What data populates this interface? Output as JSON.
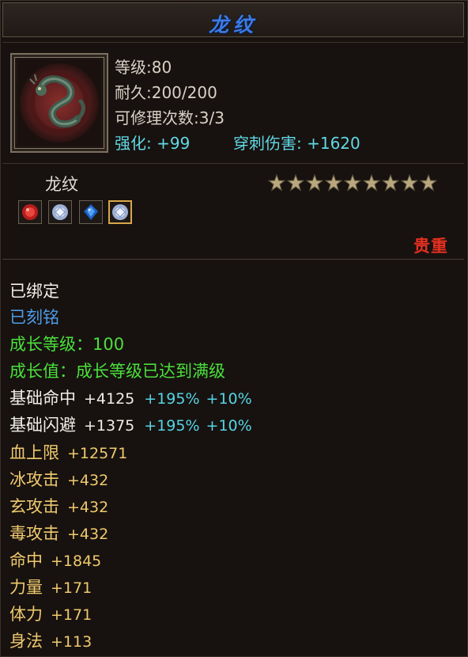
{
  "title": "龙纹",
  "stats": {
    "level": "等级:80",
    "durability": "耐久:200/200",
    "repairs": "可修理次数:3/3",
    "enhance": "强化: +99",
    "pierce": "穿刺伤害: +1620"
  },
  "item_name": "龙纹",
  "stars": {
    "count": 9,
    "color": "#b9a87e"
  },
  "gems": [
    {
      "icon": "red-gem-icon",
      "color": "#d42a2a"
    },
    {
      "icon": "white-gem-icon",
      "color": "#dfe8f6"
    },
    {
      "icon": "blue-gem-icon",
      "color": "#2f7fe6"
    },
    {
      "icon": "white-gem-icon",
      "color": "#dfe8f6",
      "selected": true
    }
  ],
  "rarity": "贵重",
  "attributes": {
    "bound": "已绑定",
    "engraved": "已刻铭",
    "growth_level": "成长等级：100",
    "growth_value": "成长值：成长等级已达到满级",
    "base_hit": {
      "label": "基础命中",
      "value": "+4125",
      "bonus1": "+195%",
      "bonus2": "+10%"
    },
    "base_dodge": {
      "label": "基础闪避",
      "value": "+1375",
      "bonus1": "+195%",
      "bonus2": "+10%"
    },
    "hp": {
      "label": "血上限",
      "value": "+12571"
    },
    "ice": {
      "label": "冰攻击",
      "value": "+432"
    },
    "mystic": {
      "label": "玄攻击",
      "value": "+432"
    },
    "poison": {
      "label": "毒攻击",
      "value": "+432"
    },
    "hit": {
      "label": "命中",
      "value": "+1845"
    },
    "strength": {
      "label": "力量",
      "value": "+171"
    },
    "stamina": {
      "label": "体力",
      "value": "+171"
    },
    "agility": {
      "label": "身法",
      "value": "+113"
    }
  }
}
